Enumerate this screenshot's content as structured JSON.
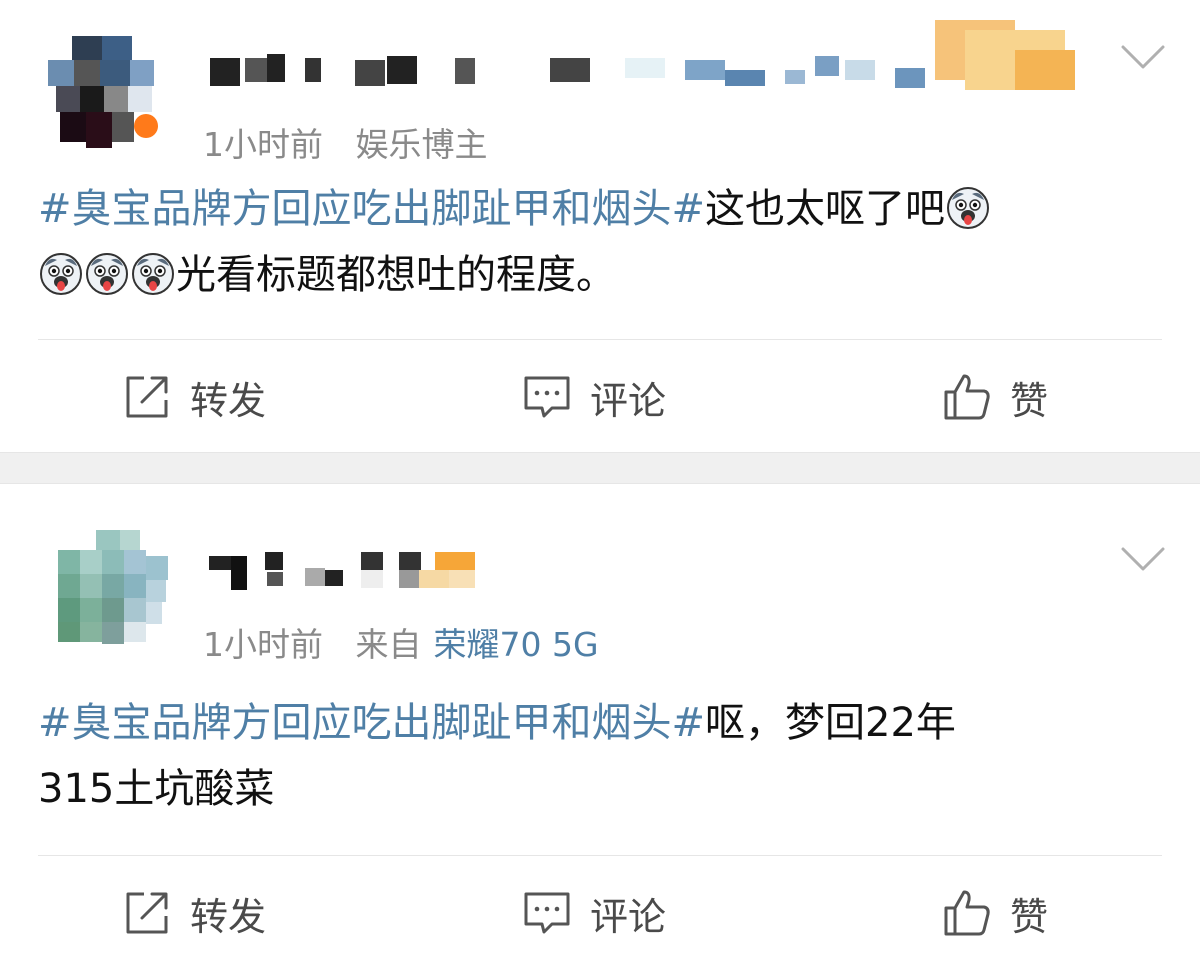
{
  "posts": [
    {
      "time": "1小时前",
      "source": "娱乐博主",
      "topic": "#臭宝品牌方回应吃出脚趾甲和烟头#",
      "text_a": "这也太呕了吧",
      "text_b": "光看标题都想吐的程度。",
      "emoji": "doge-tongue-emoji",
      "actions": {
        "repost": "转发",
        "comment": "评论",
        "like": "赞"
      }
    },
    {
      "time": "1小时前",
      "source_prefix": "来自",
      "source": "荣耀70 5G",
      "topic": "#臭宝品牌方回应吃出脚趾甲和烟头#",
      "text_a": "呕，梦回22年",
      "text_b": "315土坑酸菜",
      "actions": {
        "repost": "转发",
        "comment": "评论",
        "like": "赞"
      }
    }
  ],
  "icons": {
    "repost": "share-edit-icon",
    "comment": "comment-bubble-icon",
    "like": "thumbs-up-icon",
    "more": "chevron-down-icon"
  },
  "colors": {
    "topic": "#4f7fa6",
    "meta": "#8a8a8a",
    "separator": "#f0f0f0"
  }
}
